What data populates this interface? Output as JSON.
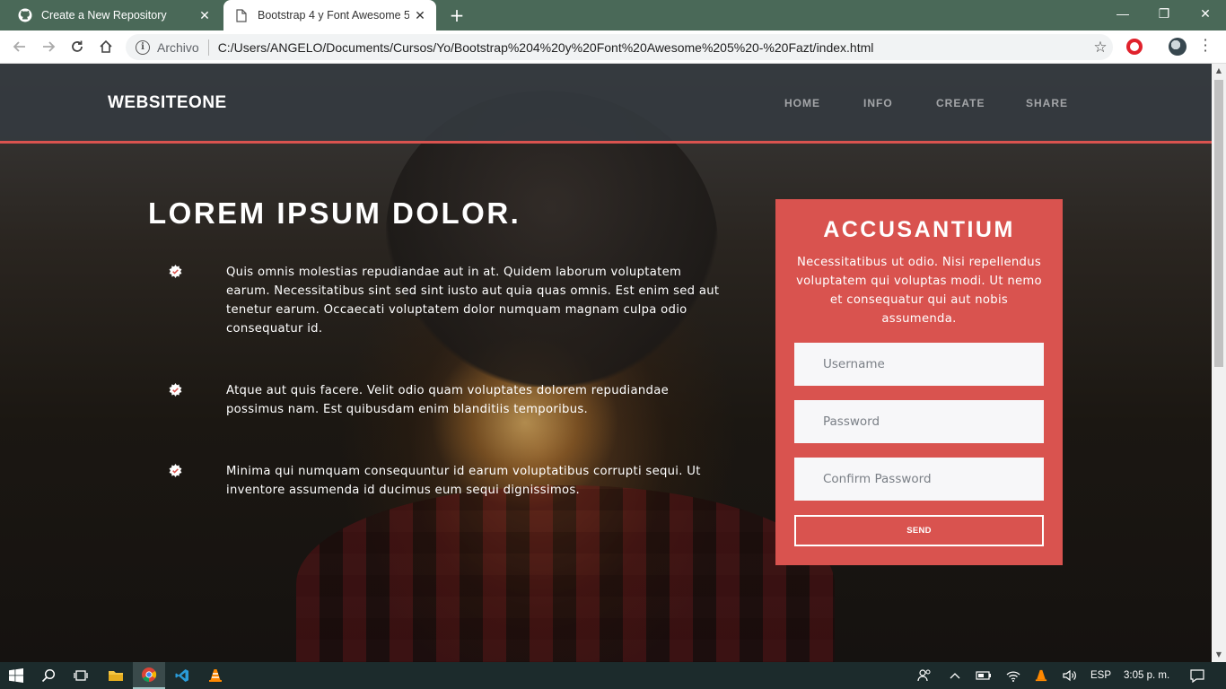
{
  "browser": {
    "tabs": [
      {
        "label": "Create a New Repository",
        "active": false
      },
      {
        "label": "Bootstrap 4 y Font Awesome 5",
        "active": true
      }
    ],
    "address": {
      "scheme_label": "Archivo",
      "url": "C:/Users/ANGELO/Documents/Cursos/Yo/Bootstrap%204%20y%20Font%20Awesome%205%20-%20Fazt/index.html"
    }
  },
  "site": {
    "brand": "WEBSITEONE",
    "nav": [
      "HOME",
      "INFO",
      "CREATE",
      "SHARE"
    ],
    "accent_color": "#d9534f"
  },
  "hero": {
    "headline": "LOREM IPSUM DOLOR.",
    "features": [
      "Quis omnis molestias repudiandae aut in at. Quidem laborum voluptatem earum. Necessitatibus sint sed sint iusto aut quia quas omnis. Est enim sed aut tenetur earum. Occaecati voluptatem dolor numquam magnam culpa odio consequatur id.",
      "Atque aut quis facere. Velit odio quam voluptates dolorem repudiandae possimus nam. Est quibusdam enim blanditiis temporibus.",
      "Minima qui numquam consequuntur id earum voluptatibus corrupti sequi. Ut inventore assumenda id ducimus eum sequi dignissimos."
    ]
  },
  "form": {
    "title": "ACCUSANTIUM",
    "description": "Necessitatibus ut odio. Nisi repellendus voluptatem qui voluptas modi. Ut nemo et consequatur qui aut nobis assumenda.",
    "username_placeholder": "Username",
    "password_placeholder": "Password",
    "confirm_placeholder": "Confirm Password",
    "send_label": "SEND"
  },
  "taskbar": {
    "language": "ESP",
    "time": "3:05 p. m."
  }
}
